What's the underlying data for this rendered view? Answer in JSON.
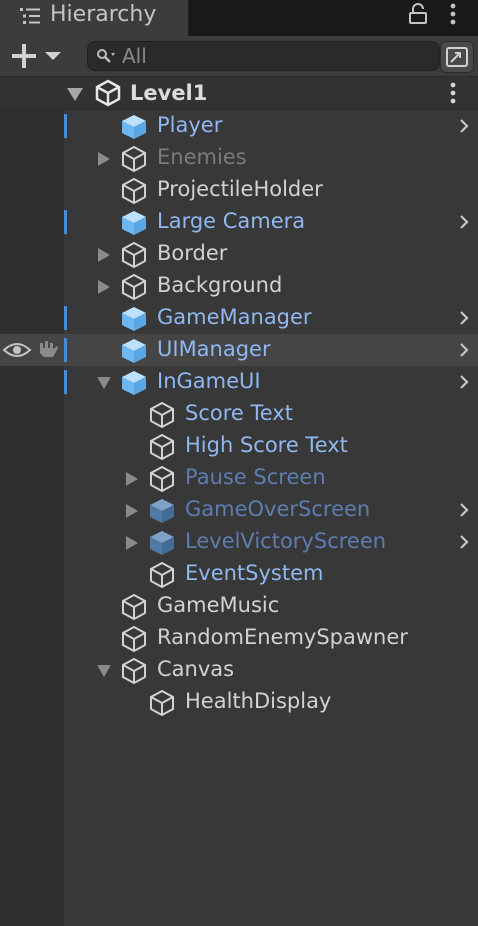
{
  "window": {
    "tab_title": "Hierarchy"
  },
  "toolbar": {
    "search_placeholder": "All"
  },
  "scene": {
    "name": "Level1"
  },
  "rows": [
    {
      "label": "Player",
      "style": "blue",
      "icon": "prefab-cube-icon",
      "indent": 1,
      "toggle": "none",
      "marker": true,
      "chevron": true
    },
    {
      "label": "Enemies",
      "style": "dim",
      "icon": "gameobject-outline-icon",
      "indent": 1,
      "toggle": "collapsed",
      "marker": false,
      "chevron": false
    },
    {
      "label": "ProjectileHolder",
      "style": "gray",
      "icon": "gameobject-outline-icon",
      "indent": 1,
      "toggle": "none",
      "marker": false,
      "chevron": false
    },
    {
      "label": "Large Camera",
      "style": "blue",
      "icon": "prefab-cube-icon",
      "indent": 1,
      "toggle": "none",
      "marker": true,
      "chevron": true
    },
    {
      "label": "Border",
      "style": "gray",
      "icon": "gameobject-outline-icon",
      "indent": 1,
      "toggle": "collapsed",
      "marker": false,
      "chevron": false
    },
    {
      "label": "Background",
      "style": "gray",
      "icon": "gameobject-outline-icon",
      "indent": 1,
      "toggle": "collapsed",
      "marker": false,
      "chevron": false
    },
    {
      "label": "GameManager",
      "style": "blue",
      "icon": "prefab-cube-icon",
      "indent": 1,
      "toggle": "none",
      "marker": true,
      "chevron": true
    },
    {
      "label": "UIManager",
      "style": "blue",
      "icon": "prefab-cube-icon",
      "indent": 1,
      "toggle": "none",
      "marker": true,
      "chevron": true,
      "hover": true
    },
    {
      "label": "InGameUI",
      "style": "blue",
      "icon": "prefab-cube-icon",
      "indent": 1,
      "toggle": "expanded",
      "marker": true,
      "chevron": true
    },
    {
      "label": "Score Text",
      "style": "blue",
      "icon": "gameobject-outline-icon",
      "indent": 2,
      "toggle": "none",
      "marker": false,
      "chevron": false
    },
    {
      "label": "High Score Text",
      "style": "blue",
      "icon": "gameobject-outline-icon",
      "indent": 2,
      "toggle": "none",
      "marker": false,
      "chevron": false
    },
    {
      "label": "Pause Screen",
      "style": "dimblue",
      "icon": "gameobject-outline-icon",
      "indent": 2,
      "toggle": "collapsed",
      "marker": false,
      "chevron": false
    },
    {
      "label": "GameOverScreen",
      "style": "dimblue",
      "icon": "prefab-cube-dim-icon",
      "indent": 2,
      "toggle": "collapsed",
      "marker": false,
      "chevron": true
    },
    {
      "label": "LevelVictoryScreen",
      "style": "dimblue",
      "icon": "prefab-cube-dim-icon",
      "indent": 2,
      "toggle": "collapsed",
      "marker": false,
      "chevron": true
    },
    {
      "label": "EventSystem",
      "style": "blue",
      "icon": "gameobject-outline-icon",
      "indent": 2,
      "toggle": "none",
      "marker": false,
      "chevron": false
    },
    {
      "label": "GameMusic",
      "style": "gray",
      "icon": "gameobject-outline-icon",
      "indent": 1,
      "toggle": "none",
      "marker": false,
      "chevron": false
    },
    {
      "label": "RandomEnemySpawner",
      "style": "gray",
      "icon": "gameobject-outline-icon",
      "indent": 1,
      "toggle": "none",
      "marker": false,
      "chevron": false
    },
    {
      "label": "Canvas",
      "style": "gray",
      "icon": "gameobject-outline-icon",
      "indent": 1,
      "toggle": "expanded",
      "marker": false,
      "chevron": false
    },
    {
      "label": "HealthDisplay",
      "style": "gray",
      "icon": "gameobject-outline-icon",
      "indent": 2,
      "toggle": "none",
      "marker": false,
      "chevron": false
    }
  ],
  "colors": {
    "prefab_blue": "#8fb8f0",
    "marker_blue": "#4a8ad0",
    "text_gray": "#d2d2d2"
  }
}
